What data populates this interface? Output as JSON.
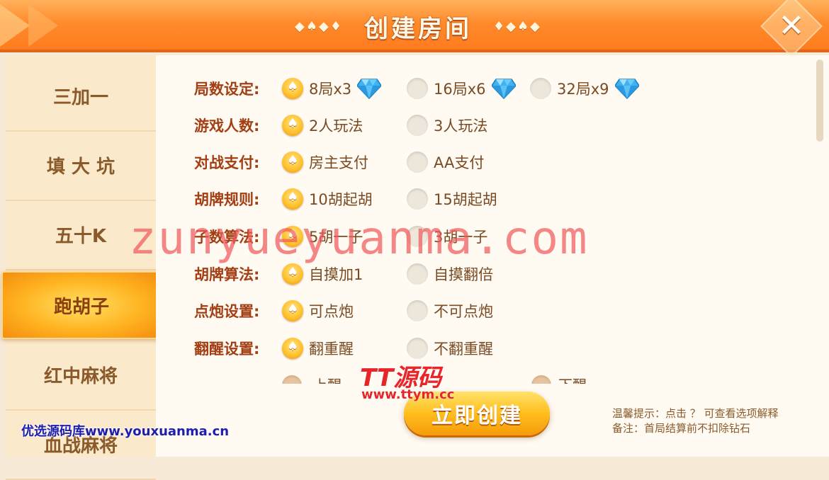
{
  "header": {
    "title": "创建房间",
    "suits_left": "◆♠◆♦",
    "suits_right": "♦◆♠◆",
    "close_icon": "close-icon"
  },
  "sidebar": {
    "items": [
      {
        "label": "三加一",
        "active": false
      },
      {
        "label": "填 大 坑",
        "active": false
      },
      {
        "label": "五十K",
        "active": false
      },
      {
        "label": "跑胡子",
        "active": true
      },
      {
        "label": "红中麻将",
        "active": false
      },
      {
        "label": "血战麻将",
        "active": false
      }
    ]
  },
  "settings": [
    {
      "label": "局数设定:",
      "options": [
        {
          "text": "8局x3",
          "selected": true,
          "gem": true
        },
        {
          "text": "16局x6",
          "selected": false,
          "gem": true
        },
        {
          "text": "32局x9",
          "selected": false,
          "gem": true
        }
      ]
    },
    {
      "label": "游戏人数:",
      "options": [
        {
          "text": "2人玩法",
          "selected": true
        },
        {
          "text": "3人玩法",
          "selected": false
        }
      ]
    },
    {
      "label": "对战支付:",
      "options": [
        {
          "text": "房主支付",
          "selected": true
        },
        {
          "text": "AA支付",
          "selected": false
        }
      ]
    },
    {
      "label": "胡牌规则:",
      "options": [
        {
          "text": "10胡起胡",
          "selected": true
        },
        {
          "text": "15胡起胡",
          "selected": false
        }
      ]
    },
    {
      "label": "子数算法:",
      "options": [
        {
          "text": "5胡一子",
          "selected": true
        },
        {
          "text": "3胡一子",
          "selected": false
        }
      ]
    },
    {
      "label": "胡牌算法:",
      "options": [
        {
          "text": "自摸加1",
          "selected": true
        },
        {
          "text": "自摸翻倍",
          "selected": false
        }
      ]
    },
    {
      "label": "点炮设置:",
      "options": [
        {
          "text": "可点炮",
          "selected": true
        },
        {
          "text": "不可点炮",
          "selected": false
        }
      ]
    },
    {
      "label": "翻醒设置:",
      "options": [
        {
          "text": "翻重醒",
          "selected": true
        },
        {
          "text": "不翻重醒",
          "selected": false
        }
      ]
    }
  ],
  "partial_row": {
    "left_text": "上醒",
    "right_text": "下醒"
  },
  "create_button": "立即创建",
  "tips": {
    "line1": "温馨提示：点击 ？ 可查看选项解释",
    "line2": "备注：首局结算前不扣除钻石"
  },
  "watermarks": {
    "main": "zunyueyuanma.com",
    "tt_logo": "TT源码",
    "tt_url": "www.ttym.cc",
    "bottom": "优选源码库www.youxuanma.cn"
  },
  "colors": {
    "header": "#ff8a2a",
    "label": "#a33f14",
    "option": "#7a4a22",
    "accent": "#ffbe1e"
  }
}
